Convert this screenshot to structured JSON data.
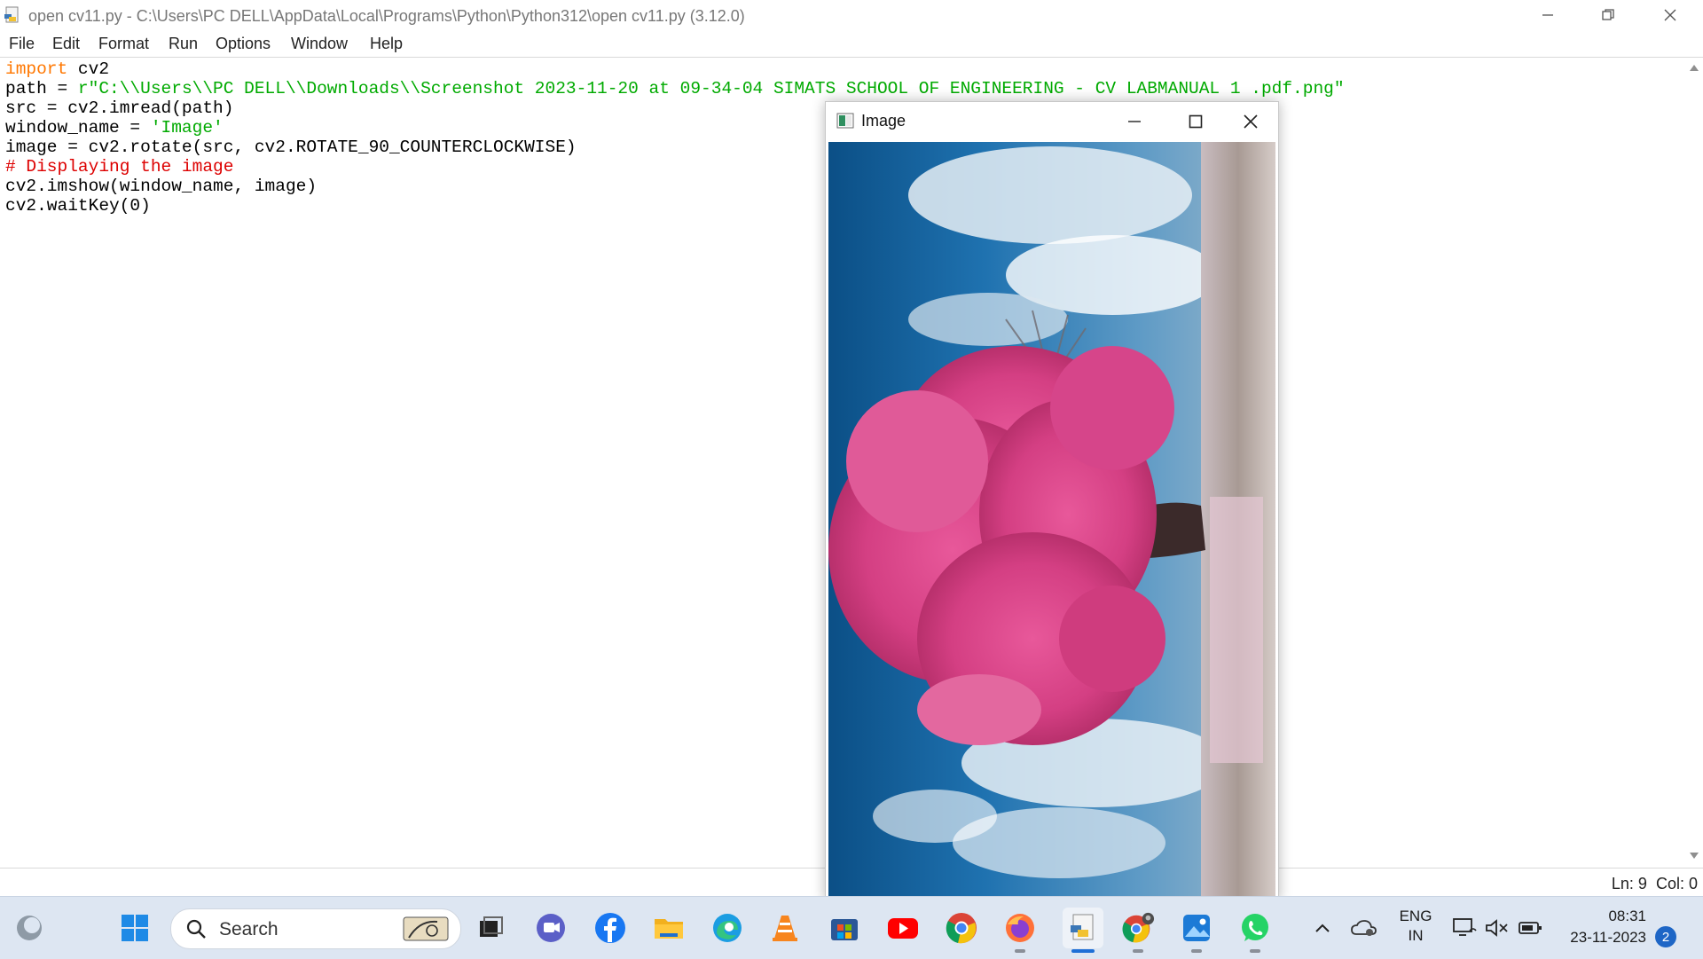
{
  "window": {
    "title": "open cv11.py - C:\\Users\\PC DELL\\AppData\\Local\\Programs\\Python\\Python312\\open cv11.py (3.12.0)"
  },
  "menu": [
    "File",
    "Edit",
    "Format",
    "Run",
    "Options",
    "Window",
    "Help"
  ],
  "code": {
    "lines": [
      [
        {
          "t": "import",
          "c": "kw"
        },
        {
          "t": " cv2"
        }
      ],
      [
        {
          "t": "path = "
        },
        {
          "t": "r\"C:\\\\Users\\\\PC DELL\\\\Downloads\\\\Screenshot 2023-11-20 at 09-34-04 SIMATS SCHOOL OF ENGINEERING - CV LABMANUAL 1 .pdf.png\"",
          "c": "str"
        }
      ],
      [
        {
          "t": "src = cv2.imread(path)"
        }
      ],
      [
        {
          "t": "window_name = "
        },
        {
          "t": "'Image'",
          "c": "str"
        }
      ],
      [
        {
          "t": "image = cv2.rotate(src, cv2.ROTATE_90_COUNTERCLOCKWISE)"
        }
      ],
      [
        {
          "t": "# Displaying the image",
          "c": "cmt"
        }
      ],
      [
        {
          "t": "cv2.imshow(window_name, image)"
        }
      ],
      [
        {
          "t": "cv2.waitKey(0)"
        }
      ]
    ]
  },
  "status": {
    "line": "Ln: 9",
    "col": "Col: 0"
  },
  "image_window": {
    "title": "Image",
    "content": "rotated photo of a pink blossom tree under blue sky"
  },
  "taskbar": {
    "search_label": "Search",
    "icons": [
      "copilot-icon",
      "start-icon",
      "task-view-icon",
      "teams-icon",
      "facebook-icon",
      "file-explorer-icon",
      "edge-icon",
      "vlc-icon",
      "store-icon",
      "youtube-icon",
      "chrome-icon",
      "firefox-icon",
      "python-idle-icon",
      "chrome-profile-icon",
      "photos-icon",
      "whatsapp-icon"
    ],
    "tray": {
      "lang_top": "ENG",
      "lang_bottom": "IN",
      "time": "08:31",
      "date": "23-11-2023",
      "notifications": "2"
    }
  },
  "colors": {
    "keyword": "#ff7700",
    "string": "#00aa00",
    "comment": "#dd0000",
    "taskbar_bg": "#dde6f2"
  }
}
